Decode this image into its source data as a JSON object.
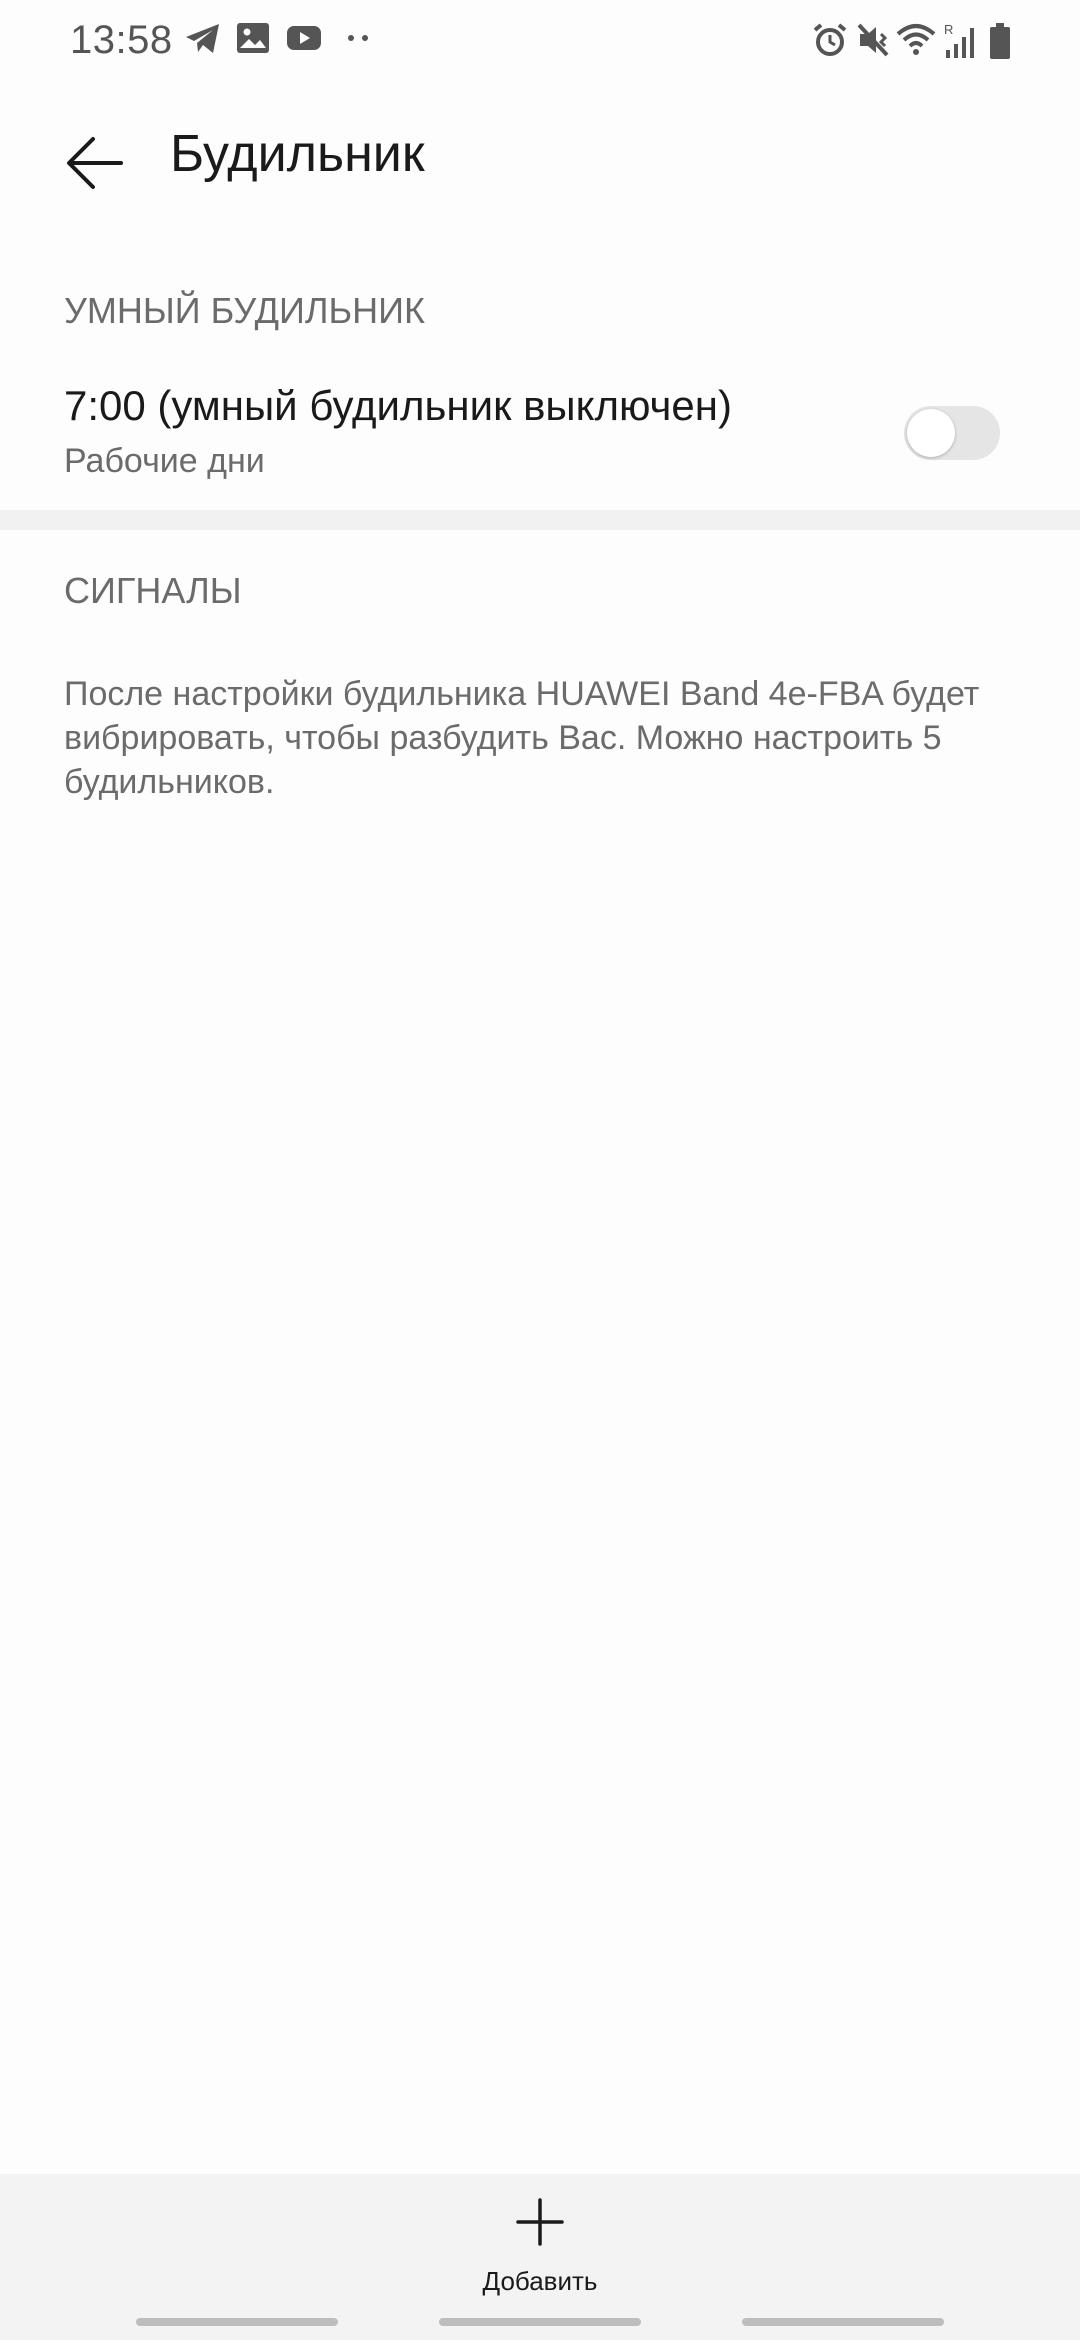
{
  "status_bar": {
    "time": "13:58",
    "left_icons": [
      "telegram-icon",
      "gallery-icon",
      "youtube-icon",
      "more-notifications-icon"
    ],
    "right_icons": [
      "alarm-icon",
      "vibrate-icon",
      "wifi-icon",
      "signal-roaming-icon",
      "battery-icon"
    ],
    "roaming_label": "R"
  },
  "header": {
    "title": "Будильник"
  },
  "smart_alarm": {
    "section_title": "УМНЫЙ БУДИЛЬНИК",
    "time_label": "7:00 (умный будильник выключен)",
    "repeat_label": "Рабочие дни",
    "enabled": false
  },
  "signals": {
    "section_title": "СИГНАЛЫ",
    "description": "После настройки будильника HUAWEI Band 4e-FBA будет вибрировать, чтобы разбудить Вас. Можно настроить 5 будильников."
  },
  "bottom_bar": {
    "add_label": "Добавить"
  }
}
